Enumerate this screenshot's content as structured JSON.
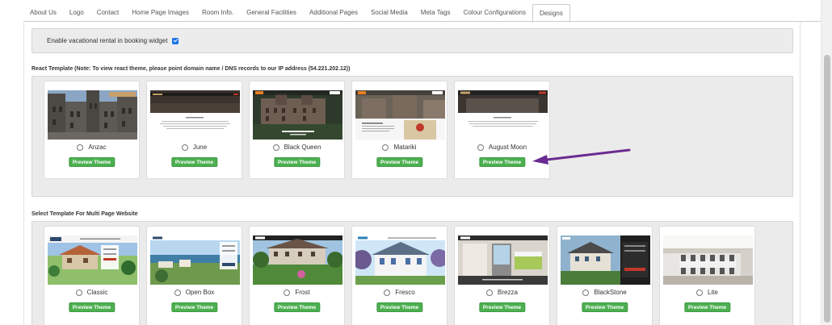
{
  "tabs": [
    "About Us",
    "Logo",
    "Contact",
    "Home Page Images",
    "Room Info.",
    "General Facilities",
    "Additional Pages",
    "Social Media",
    "Meta Tags",
    "Colour Configurations",
    "Designs"
  ],
  "active_tab": "Designs",
  "vacation_rental": {
    "label": "Enable vacational rental in booking widget",
    "checked": true
  },
  "react_section": {
    "title": "React Template (Note: To view react theme, please point domain name / DNS records to our IP address (54.221.202.12))",
    "templates": [
      "Anzac",
      "June",
      "Black Queen",
      "Matariki",
      "August Moon"
    ]
  },
  "multi_section": {
    "title": "Select Template For Multi Page Website",
    "templates": [
      "Classic",
      "Open Box",
      "Frost",
      "Fresco",
      "Brezza",
      "BlackStone",
      "Lite"
    ]
  },
  "preview_label": "Preview Theme",
  "colors": {
    "button": "#4caf50",
    "checkbox": "#1a73e8",
    "arrow": "#6a2c91"
  },
  "icons": {
    "checkbox": "checkbox-checked-icon",
    "radio": "radio-icon",
    "annotation": "arrow-icon"
  }
}
